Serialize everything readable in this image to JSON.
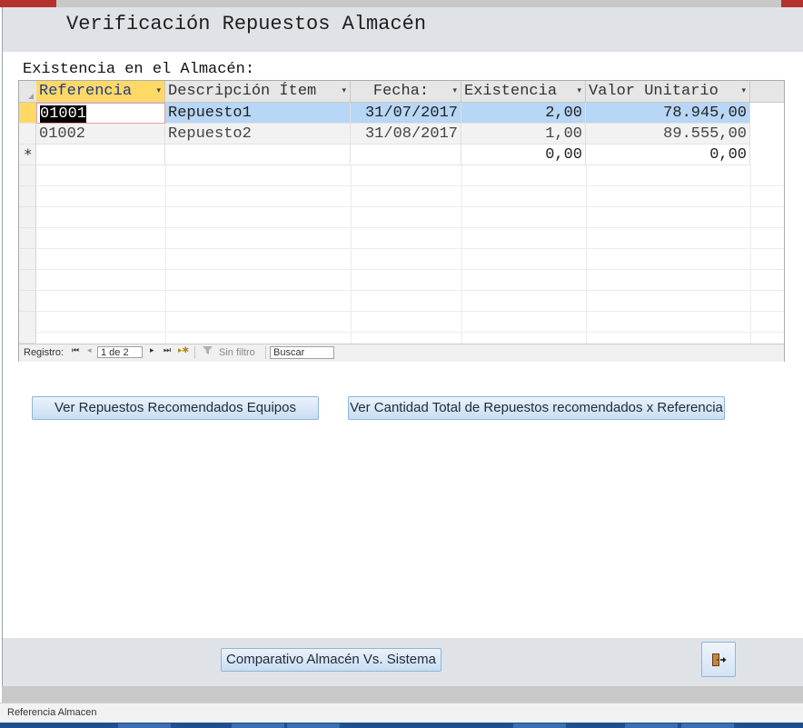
{
  "form": {
    "title": "Verificación Repuestos Almacén",
    "subform_label": "Existencia en el Almacén:"
  },
  "datasheet": {
    "columns": [
      {
        "label": "Referencia",
        "arrow": "▾"
      },
      {
        "label": "Descripción Ítem",
        "arrow": "▾"
      },
      {
        "label": "Fecha:",
        "arrow": "▾"
      },
      {
        "label": "Existencia",
        "arrow": "▾"
      },
      {
        "label": "Valor Unitario",
        "arrow": "▾"
      }
    ],
    "rows": [
      {
        "referencia": "01001",
        "descripcion": "Repuesto1",
        "fecha": "31/07/2017",
        "existencia": "2,00",
        "valor": "78.945,00"
      },
      {
        "referencia": "01002",
        "descripcion": "Repuesto2",
        "fecha": "31/08/2017",
        "existencia": "1,00",
        "valor": "89.555,00"
      }
    ],
    "new_row": {
      "marker": "*",
      "existencia": "0,00",
      "valor": "0,00"
    }
  },
  "navigation": {
    "label": "Registro:",
    "first": "⏮",
    "prev": "◂",
    "record": "1 de 2",
    "next": "▸",
    "last": "⏭",
    "new": "▸✱",
    "filter_icon": "funnel-icon",
    "filter_text": "Sin filtro",
    "search_text": "Buscar"
  },
  "buttons": {
    "recomendados": "Ver Repuestos Recomendados  Equipos",
    "cantidad_total": "Ver Cantidad Total de Repuestos recomendados x Referencia",
    "comparativo": "Comparativo Almacén Vs. Sistema",
    "exit_icon": "exit-door-icon"
  },
  "status": {
    "text": "Referencia Almacen"
  }
}
